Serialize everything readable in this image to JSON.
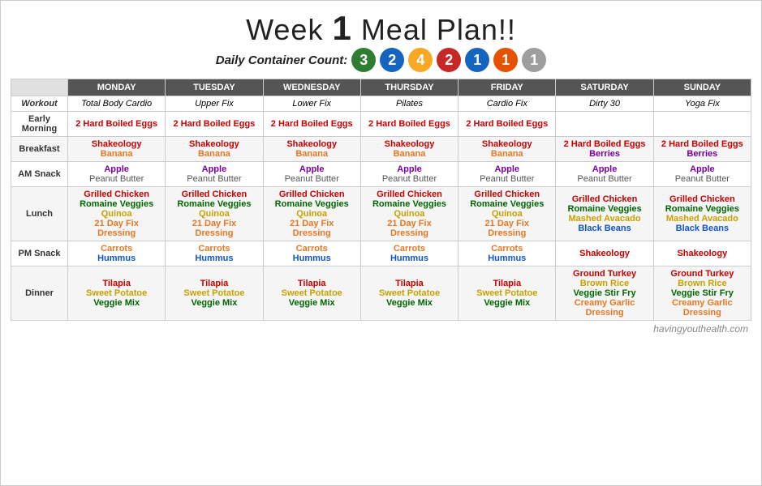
{
  "header": {
    "title_part1": "Week ",
    "title_num": "1",
    "title_part2": " Meal Plan!!",
    "subtitle": "Daily Container Count:",
    "containers": [
      {
        "value": "3",
        "color": "#2e7d32"
      },
      {
        "value": "2",
        "color": "#1565c0"
      },
      {
        "value": "4",
        "color": "#f9a825"
      },
      {
        "value": "2",
        "color": "#c62828"
      },
      {
        "value": "1",
        "color": "#1565c0"
      },
      {
        "value": "1",
        "color": "#e65100"
      },
      {
        "value": "1",
        "color": "#9e9e9e"
      }
    ]
  },
  "days": [
    "MONDAY",
    "TUESDAY",
    "WEDNESDAY",
    "THURSDAY",
    "FRIDAY",
    "SATURDAY",
    "SUNDAY"
  ],
  "rows": {
    "workout": {
      "label": "Workout",
      "days": [
        "Total Body Cardio",
        "Upper Fix",
        "Lower Fix",
        "Pilates",
        "Cardio Fix",
        "Dirty 30",
        "Yoga Fix"
      ]
    },
    "early_morning": {
      "label": "Early Morning",
      "days": [
        "2 Hard Boiled Eggs",
        "2 Hard Boiled Eggs",
        "2 Hard Boiled Eggs",
        "2 Hard Boiled Eggs",
        "2 Hard Boiled Eggs",
        "",
        ""
      ]
    },
    "breakfast": {
      "label": "Breakfast",
      "mon": [
        "Shakeology",
        "Banana"
      ],
      "tue": [
        "Shakeology",
        "Banana"
      ],
      "wed": [
        "Shakeology",
        "Banana"
      ],
      "thu": [
        "Shakeology",
        "Banana"
      ],
      "fri": [
        "Shakeology",
        "Banana"
      ],
      "sat": [
        "2 Hard Boiled Eggs",
        "Berries"
      ],
      "sun": [
        "2 Hard Boiled Eggs",
        "Berries"
      ]
    },
    "am_snack": {
      "label": "AM Snack",
      "line1": [
        "Apple",
        "Apple",
        "Apple",
        "Apple",
        "Apple",
        "Apple",
        "Apple"
      ],
      "line2": [
        "Peanut Butter",
        "Peanut Butter",
        "Peanut Butter",
        "Peanut Butter",
        "Peanut Butter",
        "Peanut Butter",
        "Peanut Butter"
      ]
    },
    "lunch": {
      "label": "Lunch",
      "mon": [
        "Grilled Chicken",
        "Romaine Veggies",
        "Quinoa",
        "21 Day Fix",
        "Dressing"
      ],
      "tue": [
        "Grilled Chicken",
        "Romaine Veggies",
        "Quinoa",
        "21 Day Fix",
        "Dressing"
      ],
      "wed": [
        "Grilled Chicken",
        "Romaine Veggies",
        "Quinoa",
        "21 Day Fix",
        "Dressing"
      ],
      "thu": [
        "Grilled Chicken",
        "Romaine Veggies",
        "Quinoa",
        "21 Day Fix",
        "Dressing"
      ],
      "fri": [
        "Grilled Chicken",
        "Romaine Veggies",
        "Quinoa",
        "21 Day Fix",
        "Dressing"
      ],
      "sat": [
        "Grilled Chicken",
        "Romaine Veggies",
        "Mashed Avacado",
        "Black Beans"
      ],
      "sun": [
        "Grilled Chicken",
        "Romaine Veggies",
        "Mashed Avacado",
        "Black Beans"
      ]
    },
    "pm_snack": {
      "label": "PM Snack",
      "line1": [
        "Carrots",
        "Carrots",
        "Carrots",
        "Carrots",
        "Carrots",
        "Shakeology",
        "Shakeology"
      ],
      "line2": [
        "Hummus",
        "Hummus",
        "Hummus",
        "Hummus",
        "Hummus",
        "",
        ""
      ]
    },
    "dinner": {
      "label": "Dinner",
      "mon": [
        "Tilapia",
        "Sweet Potatoe",
        "Veggie Mix"
      ],
      "tue": [
        "Tilapia",
        "Sweet Potatoe",
        "Veggie Mix"
      ],
      "wed": [
        "Tilapia",
        "Sweet Potatoe",
        "Veggie Mix"
      ],
      "thu": [
        "Tilapia",
        "Sweet Potatoe",
        "Veggie Mix"
      ],
      "fri": [
        "Tilapia",
        "Sweet Potatoe",
        "Veggie Mix"
      ],
      "sat": [
        "Ground Turkey",
        "Brown Rice",
        "Veggie Stir Fry",
        "Creamy Garlic",
        "Dressing"
      ],
      "sun": [
        "Ground Turkey",
        "Brown Rice",
        "Veggie Stir Fry",
        "Creamy Garlic",
        "Dressing"
      ]
    }
  },
  "watermark": "havingyouthealth.com"
}
